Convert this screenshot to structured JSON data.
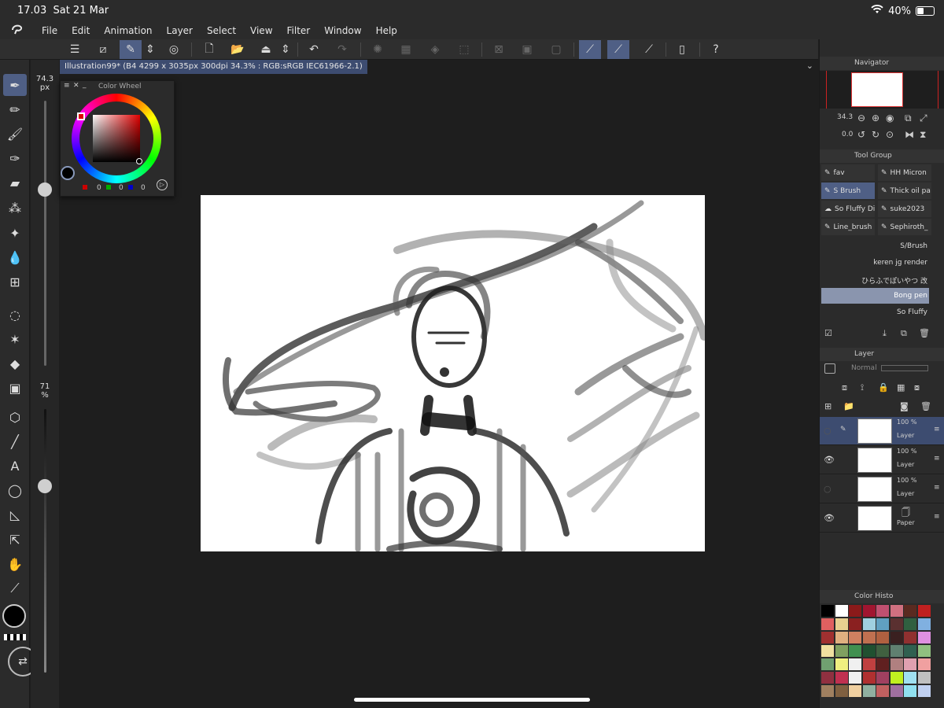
{
  "status": {
    "time": "17.03",
    "date": "Sat 21 Mar",
    "battery": "40%"
  },
  "menu": [
    "File",
    "Edit",
    "Animation",
    "Layer",
    "Select",
    "View",
    "Filter",
    "Window",
    "Help"
  ],
  "document": {
    "tab_title": "Illustration99* (B4 4299 x 3035px 300dpi 34.3% : RGB:sRGB IEC61966-2.1)"
  },
  "brush_size": {
    "value": "74.3",
    "unit": "px"
  },
  "opacity": {
    "value": "71",
    "unit": "%"
  },
  "color_wheel": {
    "title": "Color Wheel",
    "r": "0",
    "g": "0",
    "b": "0"
  },
  "navigator": {
    "title": "Navigator",
    "zoom": "34.3",
    "rotation": "0.0"
  },
  "tool_group": {
    "title": "Tool Group",
    "items": [
      {
        "label": "fav",
        "selected": false
      },
      {
        "label": "HH Micron",
        "selected": false
      },
      {
        "label": "S Brush",
        "selected": true
      },
      {
        "label": "Thick oil pa",
        "selected": false
      },
      {
        "label": "So Fluffy Di",
        "selected": false
      },
      {
        "label": "suke2023",
        "selected": false
      },
      {
        "label": "Line_brush",
        "selected": false
      },
      {
        "label": "Sephiroth_",
        "selected": false
      }
    ],
    "brushes": [
      {
        "label": "S/Brush",
        "selected": false
      },
      {
        "label": "keren jg render",
        "selected": false
      },
      {
        "label": "ひらふでぽいやつ 改",
        "selected": false
      },
      {
        "label": "Bong pen",
        "selected": true
      },
      {
        "label": "So Fluffy",
        "selected": false
      }
    ]
  },
  "layer_panel": {
    "title": "Layer",
    "blend_mode": "Normal",
    "layers": [
      {
        "opacity": "100 %",
        "name": "Layer",
        "visible": false,
        "selected": true
      },
      {
        "opacity": "100 %",
        "name": "Layer",
        "visible": true,
        "selected": false
      },
      {
        "opacity": "100 %",
        "name": "Layer",
        "visible": false,
        "selected": false
      },
      {
        "opacity": "",
        "name": "Paper",
        "visible": true,
        "selected": false
      }
    ]
  },
  "color_history": {
    "title": "Color History",
    "colors": [
      "#000000",
      "#ffffff",
      "#8b1a1a",
      "#a01530",
      "#c05070",
      "#d07080",
      "#5a2a20",
      "#c02020",
      "#e06060",
      "#e8d090",
      "#8a2020",
      "#a0d0e0",
      "#60a0c0",
      "#5a3030",
      "#306040",
      "#80b0e0",
      "#a03030",
      "#e0b080",
      "#d08060",
      "#c07050",
      "#b06040",
      "#3a2020",
      "#903030",
      "#e090e0",
      "#f0e0a0",
      "#80a060",
      "#409050",
      "#205030",
      "#406040",
      "#608070",
      "#306050",
      "#90c080",
      "#70a070",
      "#f0f080",
      "#f0f0f0",
      "#c04040",
      "#602020",
      "#b08080",
      "#e0a0b0",
      "#f0a0a0",
      "#903040",
      "#c03050",
      "#f0f0f0",
      "#b03030",
      "#a04060",
      "#c0f020",
      "#a0e0f0",
      "#c0c0c0",
      "#a08060",
      "#806040",
      "#f0d0a0",
      "#90b0a0",
      "#c06060",
      "#a070a0",
      "#90e0f0",
      "#c0d0f0"
    ]
  },
  "colors": {
    "accent": "#4f5f85",
    "panel": "#2b2b2b",
    "bg": "#1e1e1e"
  }
}
